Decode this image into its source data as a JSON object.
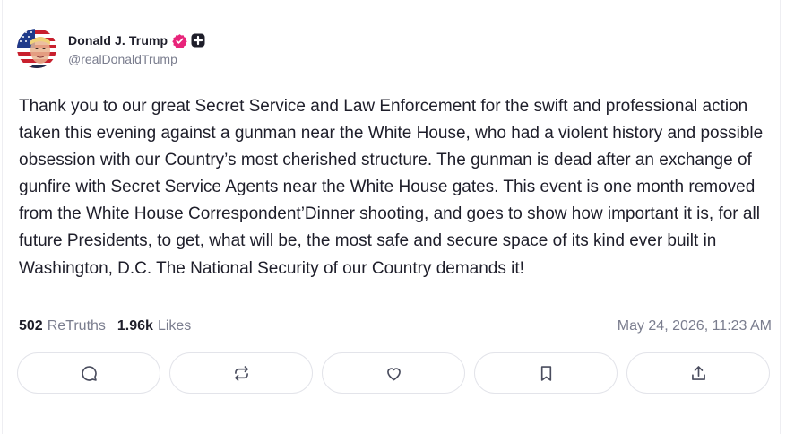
{
  "author": {
    "display_name": "Donald J. Trump",
    "handle": "@realDonaldTrump",
    "verified_color": "#e8247a"
  },
  "post": {
    "text": "Thank you to our great Secret Service and Law Enforcement for the swift and professional action taken this evening against a gunman near the White House, who had a violent history and possible obsession with our Country’s most cherished structure. The gunman is dead after an exchange of gunfire with Secret Service Agents near the White House gates. This event is one month removed from the White House Correspondent’Dinner shooting, and goes to show how important it is, for all future Presidents, to get, what will be, the most safe and secure space of its kind ever built in Washington, D.C. The National Security of our Country demands it!"
  },
  "stats": {
    "retruths_count": "502",
    "retruths_label": "ReTruths",
    "likes_count": "1.96k",
    "likes_label": "Likes",
    "timestamp": "May 24, 2026, 11:23 AM"
  },
  "actions": [
    {
      "icon": "reply-icon"
    },
    {
      "icon": "retruth-icon"
    },
    {
      "icon": "like-icon"
    },
    {
      "icon": "bookmark-icon"
    },
    {
      "icon": "share-icon"
    }
  ]
}
